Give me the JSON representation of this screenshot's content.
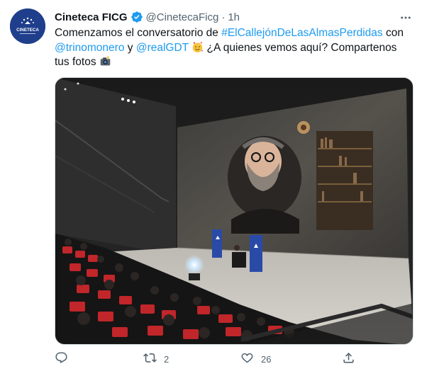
{
  "tweet": {
    "display_name": "Cineteca FICG",
    "handle": "@CinetecaFicg",
    "separator": "·",
    "timestamp": "1h",
    "avatar_label": "CINETECA",
    "text": {
      "part1": "Comenzamos el conversatorio de ",
      "hashtag": "#ElCallejónDeLasAlmasPerdidas",
      "part2": " con",
      "mention1": "@trinomonero",
      "part3": " y ",
      "mention2": "@realGDT",
      "part4": " ¿A quienes vemos aquí? Compartenos tus fotos"
    },
    "actions": {
      "reply_count": "",
      "retweet_count": "2",
      "like_count": "26"
    },
    "colors": {
      "link": "#1d9bf0",
      "verified": "#1d9bf0",
      "muted": "#536471",
      "avatar_bg": "#1f3f8c"
    },
    "icons": [
      "verified-badge-icon",
      "more-options-icon",
      "reply-icon",
      "retweet-icon",
      "like-icon",
      "share-icon",
      "smiling-face-hearts-emoji",
      "camera-flash-emoji"
    ]
  }
}
